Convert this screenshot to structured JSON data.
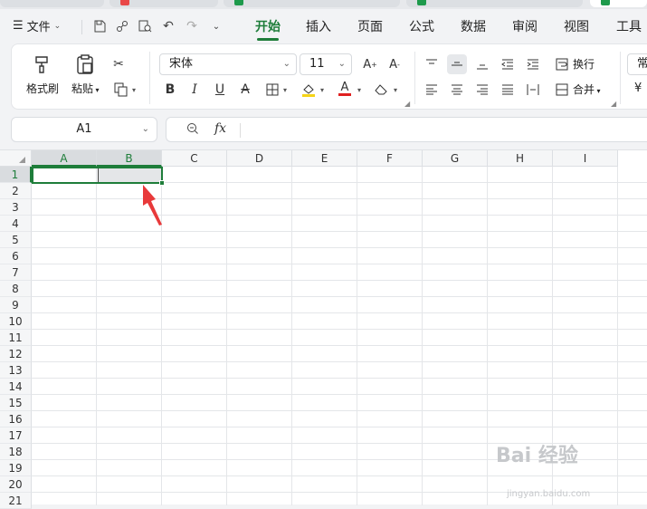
{
  "menu": {
    "file_label": "文件",
    "tabs": [
      {
        "label": "开始",
        "active": true
      },
      {
        "label": "插入",
        "active": false
      },
      {
        "label": "页面",
        "active": false
      },
      {
        "label": "公式",
        "active": false
      },
      {
        "label": "数据",
        "active": false
      },
      {
        "label": "审阅",
        "active": false
      },
      {
        "label": "视图",
        "active": false
      },
      {
        "label": "工具",
        "active": false
      }
    ]
  },
  "ribbon": {
    "format_painter": "格式刷",
    "paste": "粘贴",
    "font_name": "宋体",
    "font_size": "11",
    "wrap_text": "换行",
    "merge": "合并",
    "partial_right_top": "常",
    "partial_right_bottom": "¥"
  },
  "formula_bar": {
    "name_box": "A1",
    "fx": "fx",
    "content": ""
  },
  "sheet": {
    "columns": [
      "A",
      "B",
      "C",
      "D",
      "E",
      "F",
      "G",
      "H",
      "I"
    ],
    "rows": [
      "1",
      "2",
      "3",
      "4",
      "5",
      "6",
      "7",
      "8",
      "9",
      "10",
      "11",
      "12",
      "13",
      "14",
      "15",
      "16",
      "17",
      "18",
      "19",
      "20",
      "21"
    ],
    "selected_range": "A1:B1",
    "accent": "#1e7d3a",
    "annotation_color": "#e8393a"
  },
  "watermark": {
    "main": "Bai 经验",
    "sub": "jingyan.baidu.com"
  }
}
